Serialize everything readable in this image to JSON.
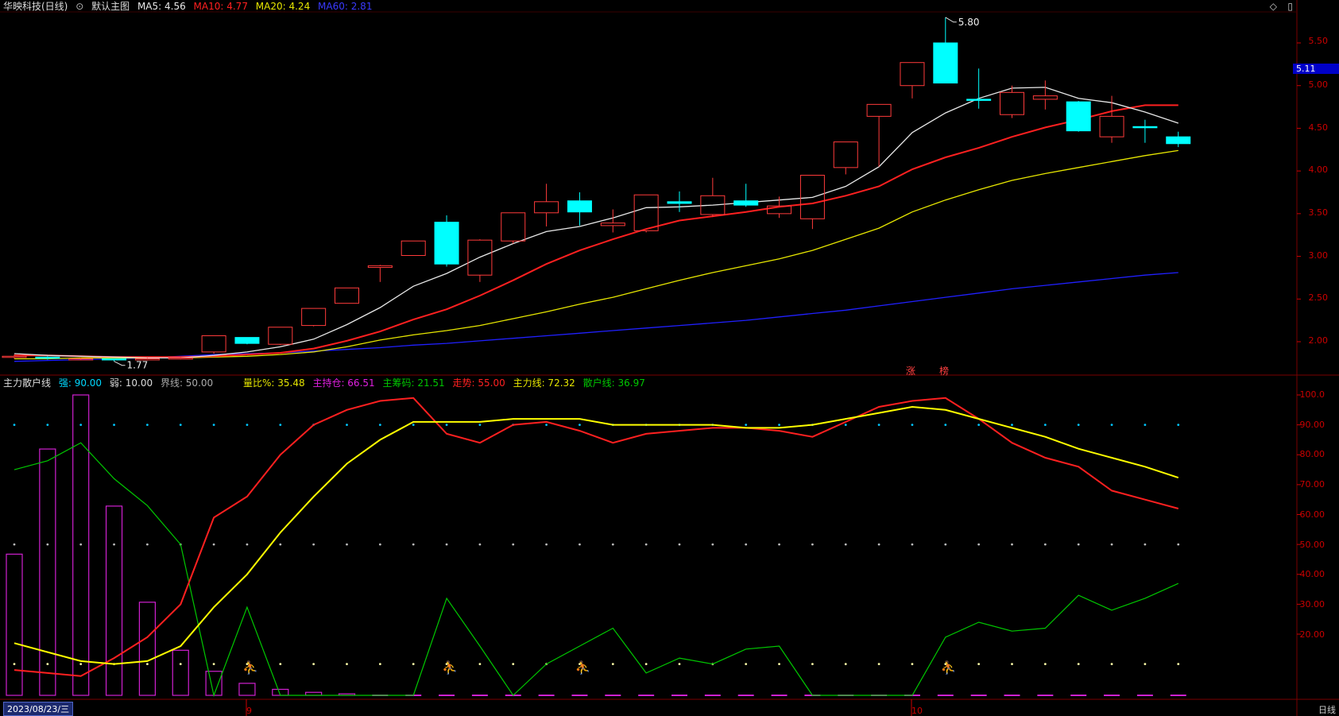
{
  "header": {
    "stock": "华映科技(日线)",
    "template_icon": "circle-chevron-icon",
    "template_label": "默认主图",
    "ma5": "MA5: 4.56",
    "ma10": "MA10: 4.77",
    "ma20": "MA20: 4.24",
    "ma60": "MA60: 2.81"
  },
  "indicator_header": {
    "name": "主力散户线",
    "strong": "强: 90.00",
    "weak": "弱: 10.00",
    "bound": "界线: 50.00",
    "volume_ratio": "量比%: 35.48",
    "main_hold": "主持仓: 66.51",
    "main_chip": "主筹码: 21.51",
    "trend": "走势: 55.00",
    "main_line": "主力线: 72.32",
    "retail_line": "散户线: 36.97"
  },
  "colors": {
    "up": "#ff3b3b",
    "down": "#00ffff",
    "ma5": "#e8e8e8",
    "ma10": "#ff2020",
    "ma20": "#e6e600",
    "ma60": "#2020ff",
    "ind_main": "#ffff00",
    "ind_trend": "#ff2020",
    "ind_chip": "#00c800",
    "bar": "#d020d0"
  },
  "price_axis": [
    "5.50",
    "5.00",
    "4.50",
    "4.00",
    "3.50",
    "3.00",
    "2.50",
    "2.00"
  ],
  "current_price_tag": "5.11",
  "annotations": {
    "high": "5.80",
    "low": "1.77"
  },
  "ind_axis": [
    "100.0",
    "90.00",
    "80.00",
    "70.00",
    "60.00",
    "50.00",
    "40.00",
    "30.00",
    "20.00"
  ],
  "markers": {
    "zhang": "涨",
    "bang": "榜"
  },
  "x_axis": {
    "date": "2023/08/23/三",
    "m9": "9",
    "m10": "10",
    "period": "日线"
  },
  "chart_data": {
    "type": "candlestick",
    "price_ylim": [
      1.7,
      5.9
    ],
    "candles": [
      {
        "o": 1.82,
        "c": 1.83,
        "h": 1.85,
        "l": 1.8
      },
      {
        "o": 1.82,
        "c": 1.81,
        "h": 1.83,
        "l": 1.79
      },
      {
        "o": 1.8,
        "c": 1.8,
        "h": 1.81,
        "l": 1.79
      },
      {
        "o": 1.8,
        "c": 1.79,
        "h": 1.8,
        "l": 1.77
      },
      {
        "o": 1.79,
        "c": 1.8,
        "h": 1.81,
        "l": 1.78
      },
      {
        "o": 1.8,
        "c": 1.81,
        "h": 1.82,
        "l": 1.79
      },
      {
        "o": 1.88,
        "c": 2.07,
        "h": 2.07,
        "l": 1.86
      },
      {
        "o": 2.05,
        "c": 1.98,
        "h": 2.05,
        "l": 1.97
      },
      {
        "o": 1.97,
        "c": 2.17,
        "h": 2.17,
        "l": 1.96
      },
      {
        "o": 2.19,
        "c": 2.39,
        "h": 2.39,
        "l": 2.18
      },
      {
        "o": 2.45,
        "c": 2.63,
        "h": 2.63,
        "l": 2.45
      },
      {
        "o": 2.87,
        "c": 2.89,
        "h": 2.9,
        "l": 2.7
      },
      {
        "o": 3.01,
        "c": 3.18,
        "h": 3.18,
        "l": 3.01
      },
      {
        "o": 3.4,
        "c": 2.91,
        "h": 3.48,
        "l": 2.88
      },
      {
        "o": 2.78,
        "c": 3.19,
        "h": 3.2,
        "l": 2.7
      },
      {
        "o": 3.18,
        "c": 3.51,
        "h": 3.51,
        "l": 3.15
      },
      {
        "o": 3.51,
        "c": 3.64,
        "h": 3.85,
        "l": 3.35
      },
      {
        "o": 3.65,
        "c": 3.52,
        "h": 3.75,
        "l": 3.36
      },
      {
        "o": 3.36,
        "c": 3.39,
        "h": 3.55,
        "l": 3.28
      },
      {
        "o": 3.3,
        "c": 3.72,
        "h": 3.72,
        "l": 3.28
      },
      {
        "o": 3.64,
        "c": 3.62,
        "h": 3.76,
        "l": 3.52
      },
      {
        "o": 3.49,
        "c": 3.71,
        "h": 3.92,
        "l": 3.46
      },
      {
        "o": 3.65,
        "c": 3.6,
        "h": 3.85,
        "l": 3.58
      },
      {
        "o": 3.5,
        "c": 3.59,
        "h": 3.7,
        "l": 3.45
      },
      {
        "o": 3.44,
        "c": 3.95,
        "h": 3.95,
        "l": 3.32
      },
      {
        "o": 4.04,
        "c": 4.34,
        "h": 4.34,
        "l": 3.96
      },
      {
        "o": 4.64,
        "c": 4.78,
        "h": 4.78,
        "l": 4.05
      },
      {
        "o": 5.0,
        "c": 5.27,
        "h": 5.27,
        "l": 4.85
      },
      {
        "o": 5.5,
        "c": 5.03,
        "h": 5.8,
        "l": 5.03
      },
      {
        "o": 4.84,
        "c": 4.83,
        "h": 5.2,
        "l": 4.73
      },
      {
        "o": 4.66,
        "c": 4.92,
        "h": 5.0,
        "l": 4.62
      },
      {
        "o": 4.84,
        "c": 4.88,
        "h": 5.06,
        "l": 4.72
      },
      {
        "o": 4.81,
        "c": 4.47,
        "h": 4.82,
        "l": 4.46
      },
      {
        "o": 4.4,
        "c": 4.64,
        "h": 4.88,
        "l": 4.33
      },
      {
        "o": 4.52,
        "c": 4.51,
        "h": 4.6,
        "l": 4.33
      },
      {
        "o": 4.4,
        "c": 4.32,
        "h": 4.46,
        "l": 4.28
      }
    ],
    "ma5": [
      1.86,
      1.84,
      1.83,
      1.82,
      1.81,
      1.81,
      1.84,
      1.88,
      1.94,
      2.03,
      2.2,
      2.4,
      2.65,
      2.8,
      2.99,
      3.15,
      3.29,
      3.35,
      3.45,
      3.57,
      3.58,
      3.6,
      3.63,
      3.66,
      3.69,
      3.82,
      4.05,
      4.45,
      4.68,
      4.85,
      4.97,
      4.98,
      4.85,
      4.8,
      4.69,
      4.56
    ],
    "ma10": [
      1.84,
      1.84,
      1.83,
      1.82,
      1.82,
      1.82,
      1.83,
      1.85,
      1.87,
      1.92,
      2.01,
      2.12,
      2.26,
      2.38,
      2.54,
      2.72,
      2.91,
      3.07,
      3.2,
      3.32,
      3.42,
      3.47,
      3.52,
      3.58,
      3.62,
      3.71,
      3.82,
      4.02,
      4.16,
      4.27,
      4.4,
      4.51,
      4.6,
      4.7,
      4.77,
      4.77
    ],
    "ma20": [
      1.8,
      1.8,
      1.81,
      1.81,
      1.81,
      1.81,
      1.82,
      1.83,
      1.85,
      1.88,
      1.94,
      2.02,
      2.08,
      2.13,
      2.19,
      2.27,
      2.35,
      2.44,
      2.52,
      2.62,
      2.72,
      2.81,
      2.89,
      2.97,
      3.07,
      3.2,
      3.33,
      3.52,
      3.66,
      3.78,
      3.89,
      3.97,
      4.04,
      4.11,
      4.18,
      4.24
    ],
    "ma60": [
      1.77,
      1.78,
      1.79,
      1.8,
      1.81,
      1.83,
      1.85,
      1.86,
      1.87,
      1.89,
      1.91,
      1.93,
      1.96,
      1.98,
      2.01,
      2.04,
      2.07,
      2.1,
      2.13,
      2.16,
      2.19,
      2.22,
      2.25,
      2.29,
      2.33,
      2.37,
      2.42,
      2.47,
      2.52,
      2.57,
      2.62,
      2.66,
      2.7,
      2.74,
      2.78,
      2.81
    ],
    "ind_ylim": [
      0,
      100
    ],
    "strong": 90,
    "bound": 50,
    "weak": 10,
    "main_line": [
      17,
      14,
      11,
      10,
      11,
      16,
      29,
      40,
      54,
      66,
      77,
      85,
      91,
      91,
      91,
      92,
      92,
      92,
      90,
      90,
      90,
      90,
      89,
      89,
      90,
      92,
      94,
      96,
      95,
      92,
      89,
      86,
      82,
      79,
      76,
      72.32
    ],
    "trend": [
      8,
      7,
      6,
      12,
      19,
      30,
      59,
      66,
      80,
      90,
      95,
      98,
      99,
      87,
      84,
      90,
      91,
      88,
      84,
      87,
      88,
      89,
      89,
      88,
      86,
      91,
      96,
      98,
      99,
      92,
      84,
      79,
      76,
      68,
      65,
      62,
      55
    ],
    "main_chip": [
      75,
      78,
      84,
      72,
      63,
      50,
      0,
      29,
      0,
      0,
      0,
      0,
      0,
      32,
      16,
      0,
      10,
      16,
      22,
      7,
      12,
      10,
      15,
      16,
      0,
      0,
      0,
      0,
      19,
      24,
      21,
      22,
      33,
      28,
      32,
      36.97
    ],
    "retail_bars": [
      47,
      82,
      100,
      63,
      31,
      15,
      8,
      4,
      2,
      1,
      0.5,
      0,
      0,
      0,
      0,
      0,
      0,
      0,
      0,
      0,
      0,
      0,
      0,
      0,
      0,
      0,
      0,
      0,
      0,
      0,
      0,
      0,
      0,
      0,
      0,
      0
    ],
    "figure_markers": [
      7,
      13,
      17,
      28
    ]
  }
}
